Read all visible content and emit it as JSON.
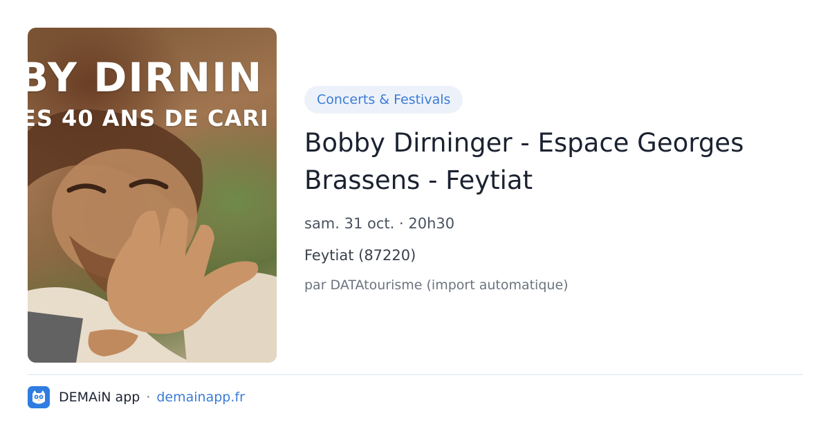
{
  "event": {
    "image_alt": "Bobby Dirninger poster",
    "image_text_line1": "BY DIRNIN",
    "image_text_line2": "ES 40 ANS DE CARI",
    "category": "Concerts & Festivals",
    "title": "Bobby Dirninger - Espace Georges Brassens - Feytiat",
    "datetime": "sam. 31 oct. · 20h30",
    "location": "Feytiat (87220)",
    "source": "par DATAtourisme (import automatique)"
  },
  "footer": {
    "app_icon": "owl-icon",
    "app_name": "DEMAiN app",
    "separator": "·",
    "link_text": "demainapp.fr"
  },
  "colors": {
    "accent": "#3a7bd5",
    "pill_background": "#edf2fa",
    "title": "#1b2230",
    "muted": "#6b737e",
    "app_icon_bg": "#2f7de1"
  }
}
